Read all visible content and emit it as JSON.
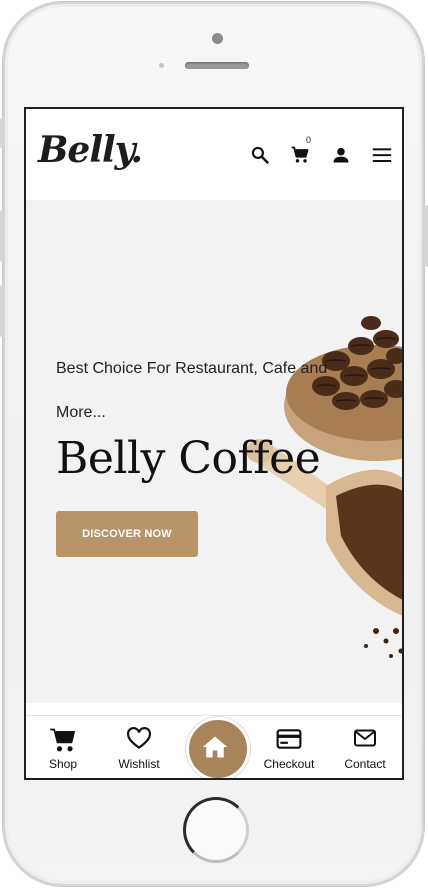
{
  "header": {
    "logo_text": "Belly.",
    "cart_count": "0",
    "icons": [
      "search-icon",
      "cart-icon",
      "user-icon",
      "menu-icon"
    ]
  },
  "hero": {
    "subtitle": "Best Choice For Restaurant, Cafe and",
    "more": "More...",
    "title": "Belly Coffee",
    "button_label": "DISCOVER NOW"
  },
  "bottom_nav": {
    "items": [
      {
        "label": "Shop",
        "icon": "cart-icon"
      },
      {
        "label": "Wishlist",
        "icon": "heart-icon"
      },
      {
        "label": "Checkout",
        "icon": "credit-card-icon"
      },
      {
        "label": "Contact",
        "icon": "mail-icon"
      }
    ],
    "home_icon": "home-icon"
  },
  "colors": {
    "accent": "#b89568",
    "home_fab": "#a9845a",
    "hero_bg": "#f2f2f2",
    "text": "#111111"
  }
}
